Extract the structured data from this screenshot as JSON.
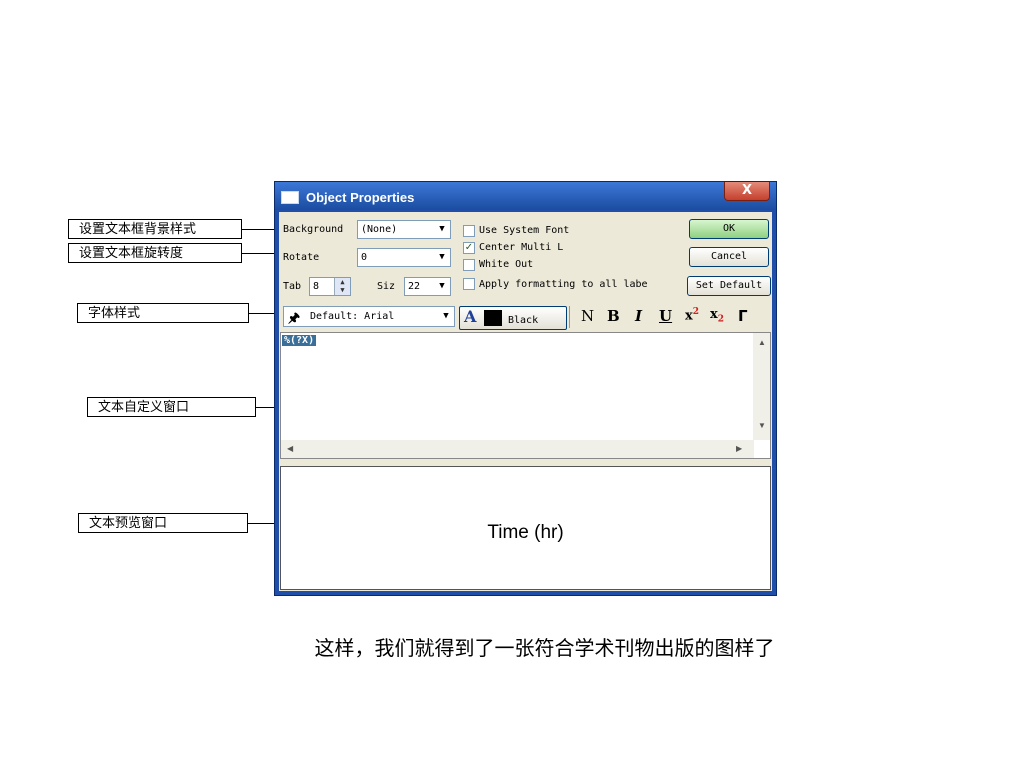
{
  "annotations": {
    "background_style": "设置文本框背景样式",
    "rotation": "设置文本框旋转度",
    "font_style": "字体样式",
    "text_window": "文本自定义窗口",
    "preview_window": "文本预览窗口"
  },
  "dialog": {
    "title": "Object Properties",
    "close": "X",
    "background_label": "Background",
    "background_value": "(None)",
    "rotate_label": "Rotate",
    "rotate_value": "0",
    "tab_label": "Tab",
    "tab_value": "8",
    "size_label": "Siz",
    "size_value": "22",
    "use_system_font": "Use System Font",
    "use_system_font_checked": false,
    "center_multi": "Center Multi L",
    "center_multi_checked": true,
    "white_out": "White Out",
    "white_out_checked": false,
    "apply_formatting": "Apply formatting to all labe",
    "apply_formatting_checked": false,
    "ok": "OK",
    "cancel": "Cancel",
    "set_default": "Set Default",
    "font_value": "Default: Arial",
    "color_letter": "A",
    "color_value": "Black",
    "format_normal": "N",
    "format_bold": "B",
    "format_italic": "I",
    "format_underline": "U",
    "format_super": "x",
    "format_sub": "x",
    "format_symbol": "Γ",
    "editor_text": "%(?X)",
    "preview_text": "Time (hr)"
  },
  "caption": "这样，我们就得到了一张符合学术刊物出版的图样了",
  "colors": {
    "titlebar": "#1f4fa8",
    "client": "#ece9d8",
    "selection": "#3a6f9a"
  }
}
